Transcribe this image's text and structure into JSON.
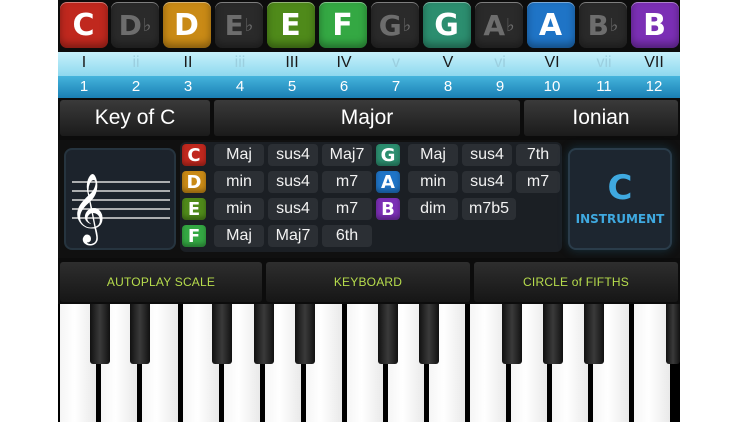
{
  "notes": [
    {
      "letter": "C",
      "flat": "",
      "color": "#c0281e",
      "active": true
    },
    {
      "letter": "D",
      "flat": "♭",
      "color": "#2a2a2a",
      "active": false
    },
    {
      "letter": "D",
      "flat": "",
      "color": "#c98a16",
      "active": true
    },
    {
      "letter": "E",
      "flat": "♭",
      "color": "#2a2a2a",
      "active": false
    },
    {
      "letter": "E",
      "flat": "",
      "color": "#4f8a1a",
      "active": true
    },
    {
      "letter": "F",
      "flat": "",
      "color": "#34a843",
      "active": true
    },
    {
      "letter": "G",
      "flat": "♭",
      "color": "#2a2a2a",
      "active": false
    },
    {
      "letter": "G",
      "flat": "",
      "color": "#2c8e6f",
      "active": true
    },
    {
      "letter": "A",
      "flat": "♭",
      "color": "#2a2a2a",
      "active": false
    },
    {
      "letter": "A",
      "flat": "",
      "color": "#1f74c6",
      "active": true
    },
    {
      "letter": "B",
      "flat": "♭",
      "color": "#2a2a2a",
      "active": false
    },
    {
      "letter": "B",
      "flat": "",
      "color": "#7b2fb5",
      "active": true
    }
  ],
  "numerals": [
    {
      "label": "I",
      "dim": false
    },
    {
      "label": "ii",
      "dim": true
    },
    {
      "label": "II",
      "dim": false
    },
    {
      "label": "iii",
      "dim": true
    },
    {
      "label": "III",
      "dim": false
    },
    {
      "label": "IV",
      "dim": false
    },
    {
      "label": "v",
      "dim": true
    },
    {
      "label": "V",
      "dim": false
    },
    {
      "label": "vi",
      "dim": true
    },
    {
      "label": "VI",
      "dim": false
    },
    {
      "label": "vii",
      "dim": true
    },
    {
      "label": "VII",
      "dim": false
    }
  ],
  "numbers": [
    "1",
    "2",
    "3",
    "4",
    "5",
    "6",
    "7",
    "8",
    "9",
    "10",
    "11",
    "12"
  ],
  "key": {
    "name": "Key of C",
    "scale": "Major",
    "mode": "Ionian"
  },
  "chords": [
    {
      "note": "C",
      "color": "#c0281e",
      "types": [
        "Maj",
        "sus4",
        "Maj7"
      ]
    },
    {
      "note": "D",
      "color": "#c98a16",
      "types": [
        "min",
        "sus4",
        "m7"
      ]
    },
    {
      "note": "E",
      "color": "#4f8a1a",
      "types": [
        "min",
        "sus4",
        "m7"
      ]
    },
    {
      "note": "F",
      "color": "#34a843",
      "types": [
        "Maj",
        "Maj7",
        "6th"
      ]
    },
    {
      "note": "G",
      "color": "#2c8e6f",
      "types": [
        "Maj",
        "sus4",
        "7th"
      ]
    },
    {
      "note": "A",
      "color": "#1f74c6",
      "types": [
        "min",
        "sus4",
        "m7"
      ]
    },
    {
      "note": "B",
      "color": "#7b2fb5",
      "types": [
        "dim",
        "m7b5"
      ]
    }
  ],
  "instrument": {
    "note": "C",
    "label": "INSTRUMENT"
  },
  "buttons": {
    "autoplay": "AUTOPLAY SCALE",
    "keyboard": "KEYBOARD",
    "circle": "CIRCLE of FIFTHS"
  },
  "icons": {
    "clef": "treble-clef-icon"
  }
}
